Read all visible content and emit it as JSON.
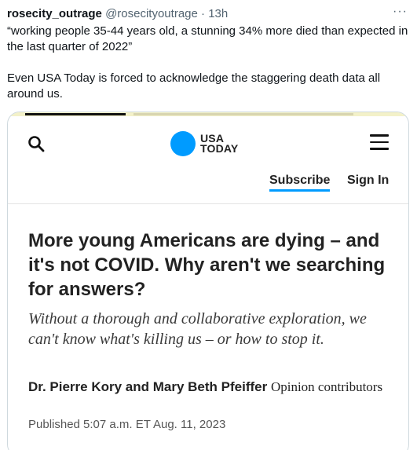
{
  "tweet": {
    "display_name": "rosecity_outrage",
    "handle": "@rosecityoutrage",
    "separator": "·",
    "time": "13h",
    "more_label": "···",
    "text_quote": "“working people 35-44 years old, a stunning 34% more died than expected in the last quarter of 2022”",
    "text_comment": "Even USA Today is forced to acknowledge the staggering death data all around us."
  },
  "embed": {
    "logo_line1": "USA",
    "logo_line2": "TODAY",
    "logo_color": "#009bff",
    "subscribe_label": "Subscribe",
    "signin_label": "Sign In",
    "headline": "More young Americans are dying – and it's not COVID. Why aren't we searching for answers?",
    "subheadline": "Without a thorough and collaborative exploration, we can't know what's killing us – or how to stop it.",
    "byline_authors": "Dr. Pierre Kory and Mary Beth Pfeiffer",
    "byline_role": "Opinion contributors",
    "published": "Published 5:07 a.m. ET Aug. 11, 2023",
    "icons": [
      "search-icon",
      "menu-icon"
    ]
  }
}
